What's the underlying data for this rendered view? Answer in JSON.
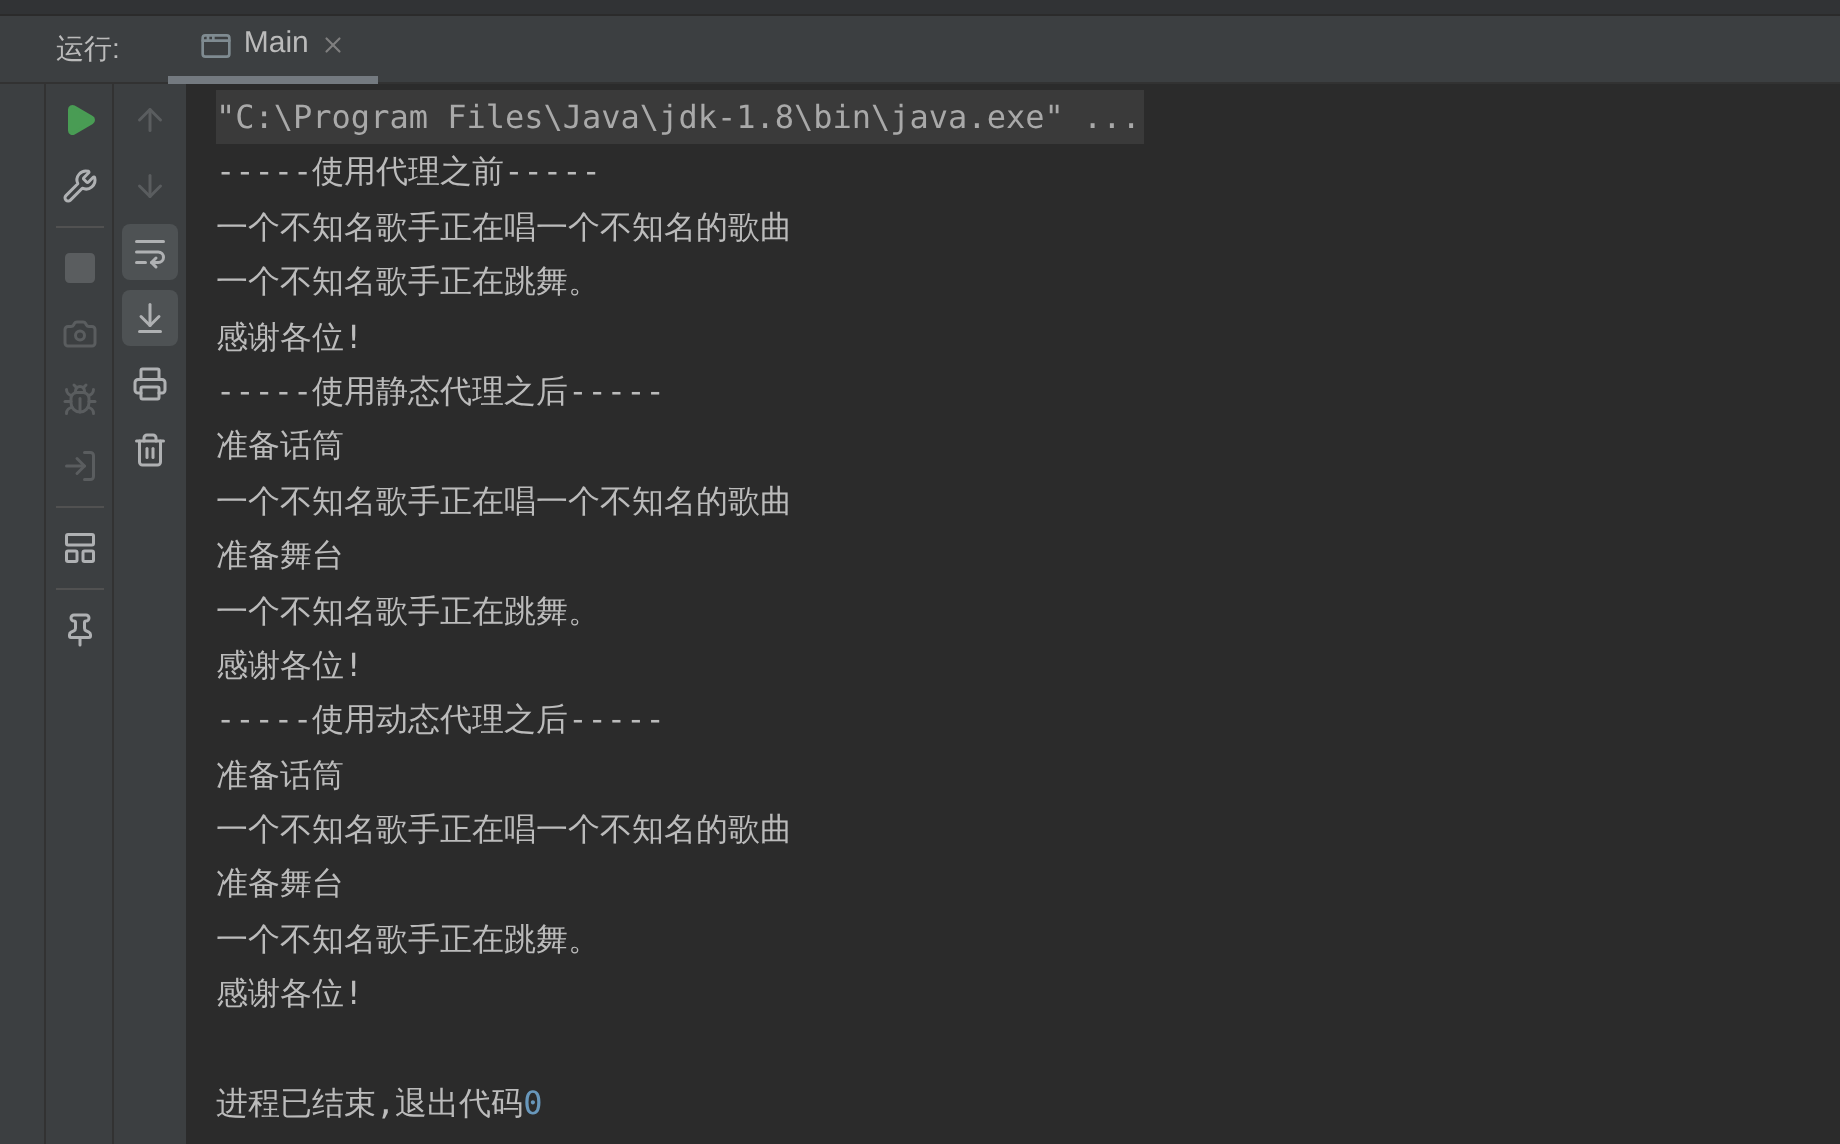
{
  "run_panel": {
    "label": "运行:",
    "tabs": [
      {
        "title": "Main",
        "selected": true
      }
    ]
  },
  "toolbar_left": [
    {
      "kind": "run",
      "disabled": false
    },
    {
      "kind": "wrench",
      "disabled": false
    },
    {
      "kind": "stop",
      "disabled": true
    },
    {
      "kind": "camera",
      "disabled": true
    },
    {
      "kind": "bug",
      "disabled": true
    },
    {
      "kind": "enter",
      "disabled": true
    },
    {
      "kind": "layout",
      "disabled": false
    },
    {
      "kind": "pin",
      "disabled": false
    }
  ],
  "toolbar_right": [
    {
      "kind": "up",
      "disabled": true,
      "on": false
    },
    {
      "kind": "down",
      "disabled": true,
      "on": false
    },
    {
      "kind": "wrap",
      "disabled": false,
      "on": true
    },
    {
      "kind": "scroll_end",
      "disabled": false,
      "on": true
    },
    {
      "kind": "print",
      "disabled": false,
      "on": false
    },
    {
      "kind": "trash",
      "disabled": false,
      "on": false
    }
  ],
  "console": {
    "command": "\"C:\\Program Files\\Java\\jdk-1.8\\bin\\java.exe\" ...",
    "lines": [
      "-----使用代理之前-----",
      "一个不知名歌手正在唱一个不知名的歌曲",
      "一个不知名歌手正在跳舞。",
      "感谢各位!",
      "-----使用静态代理之后-----",
      "准备话筒",
      "一个不知名歌手正在唱一个不知名的歌曲",
      "准备舞台",
      "一个不知名歌手正在跳舞。",
      "感谢各位!",
      "-----使用动态代理之后-----",
      "准备话筒",
      "一个不知名歌手正在唱一个不知名的歌曲",
      "准备舞台",
      "一个不知名歌手正在跳舞。",
      "感谢各位!"
    ],
    "exit_message": "进程已结束,退出代码",
    "exit_code": "0"
  }
}
